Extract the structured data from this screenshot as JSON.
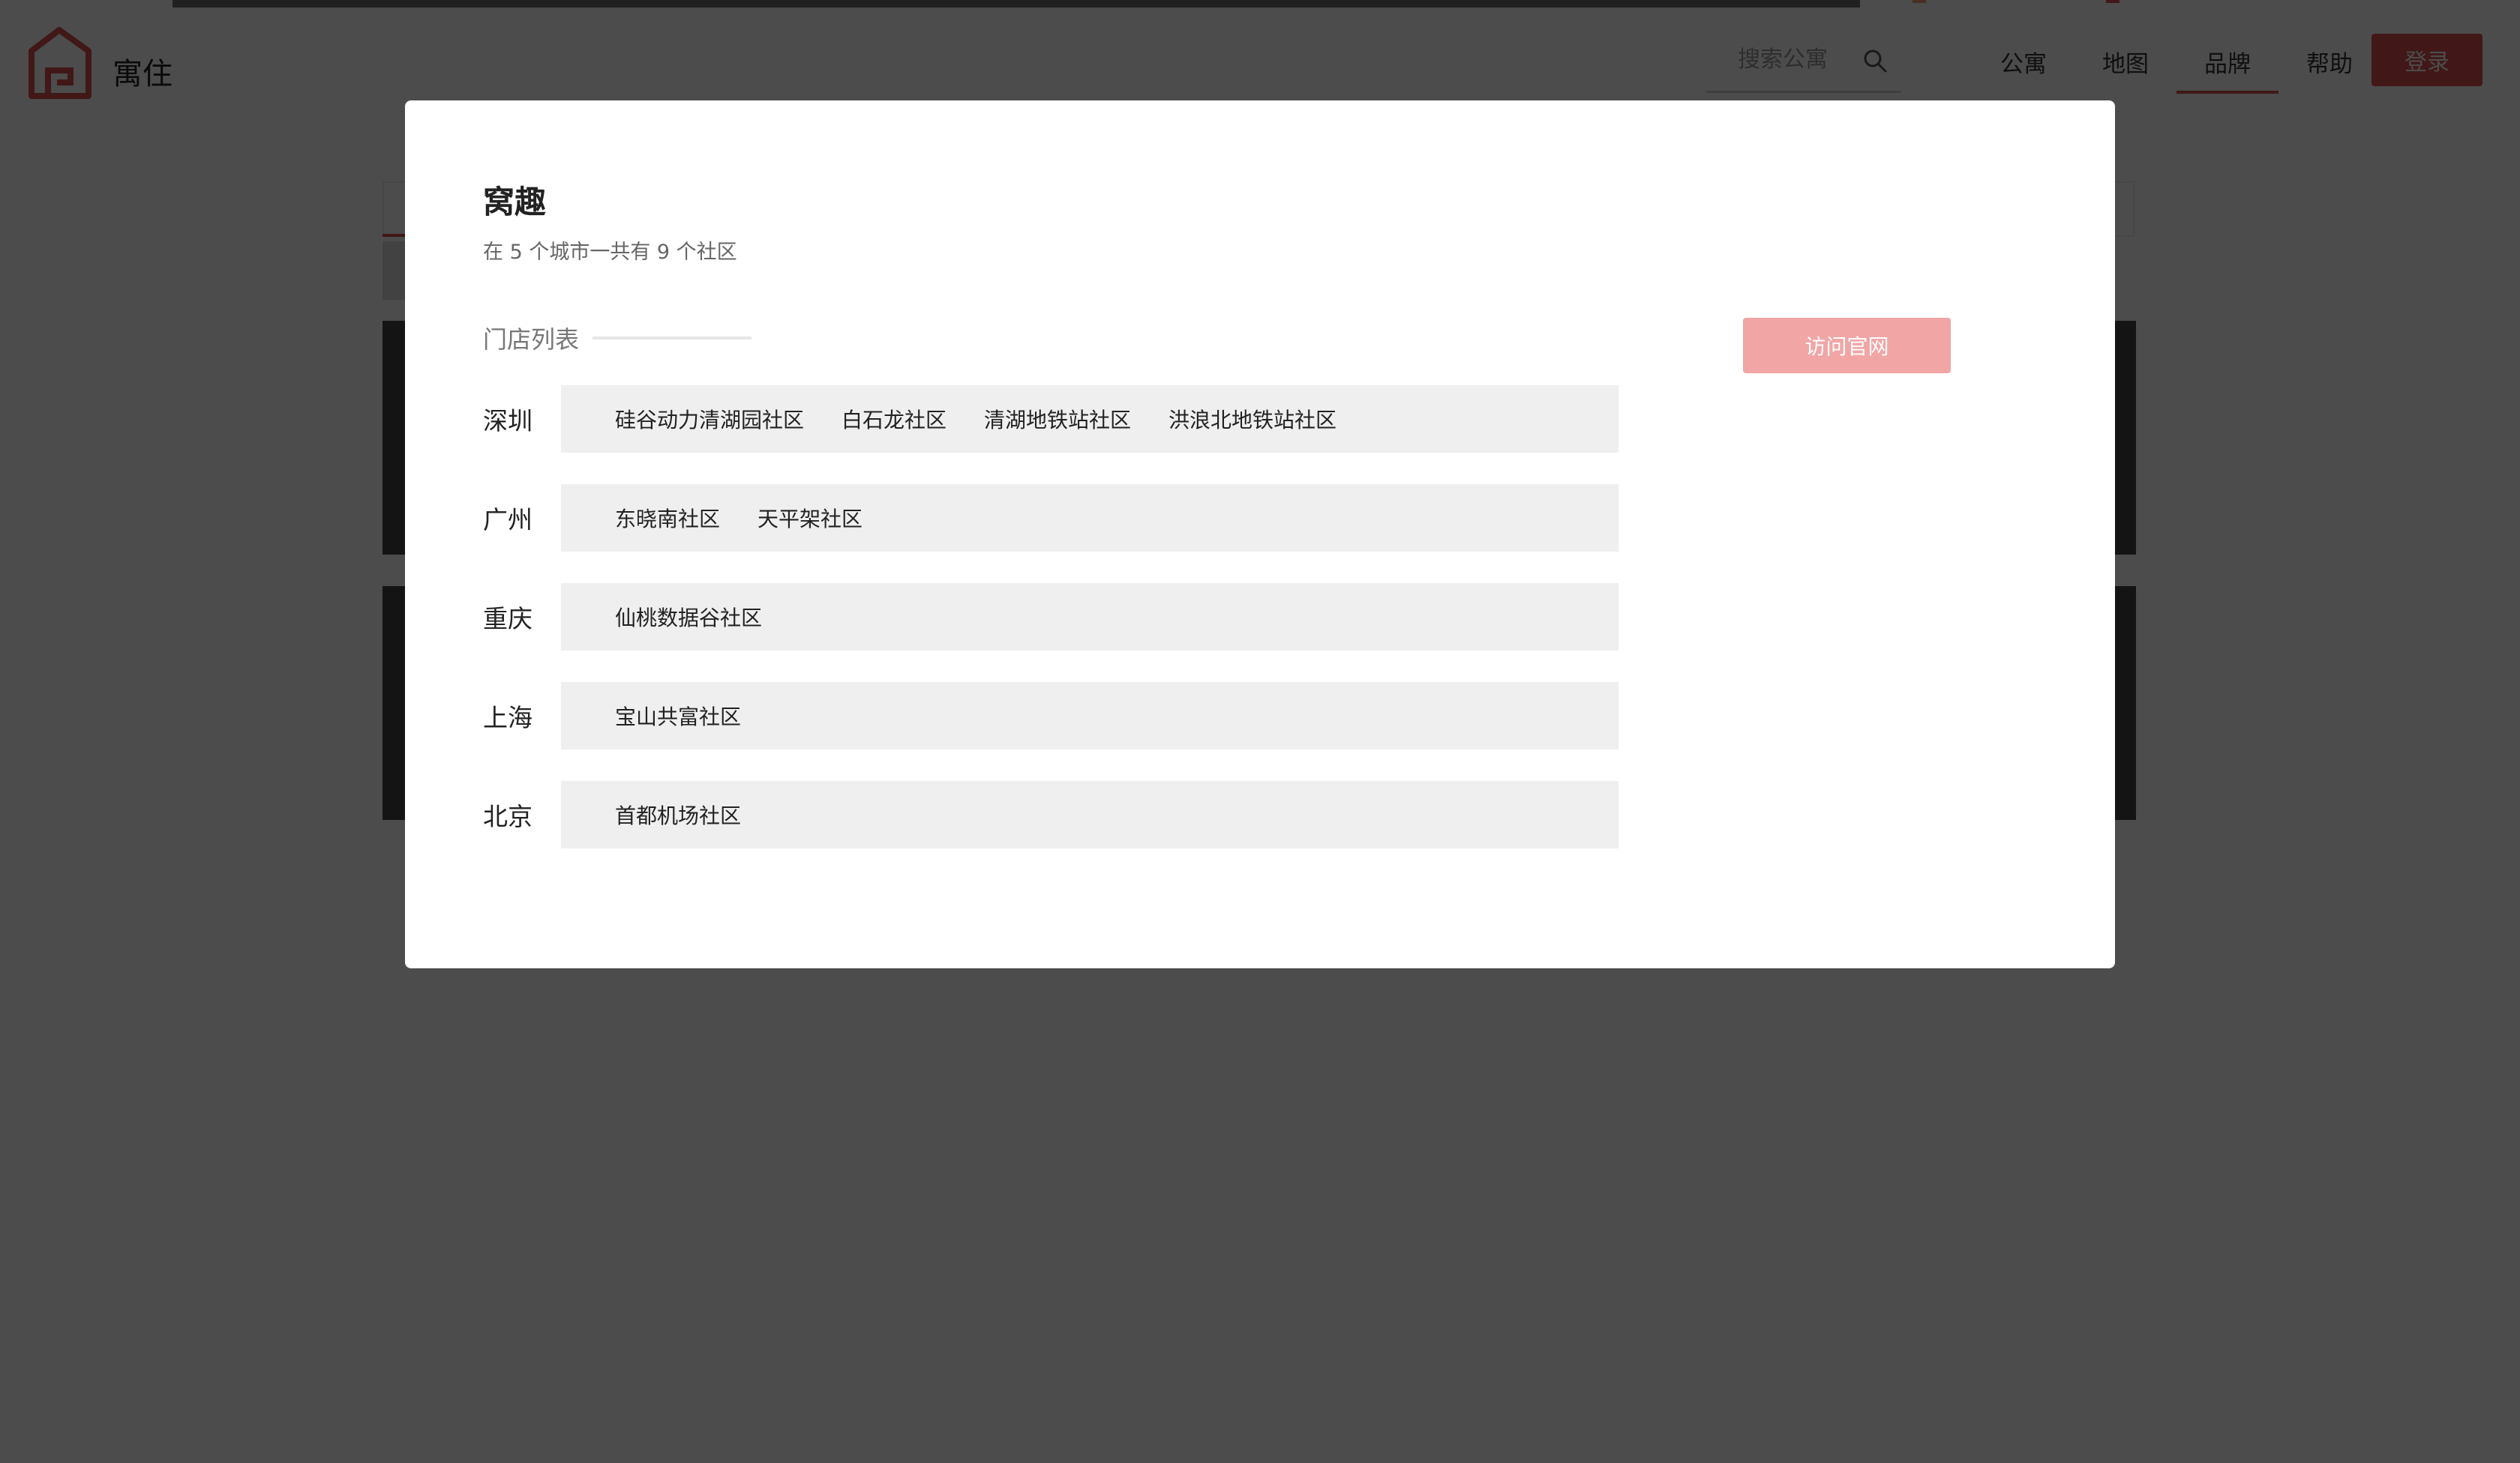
{
  "header": {
    "logo_text": "寓住",
    "search_placeholder": "搜索公寓",
    "nav": [
      "公寓",
      "地图",
      "品牌",
      "帮助"
    ],
    "active_nav": "品牌",
    "login_label": "登录"
  },
  "modal": {
    "title": "窝趣",
    "summary": "在 5 个城市一共有 9 个社区",
    "section_title": "门店列表",
    "visit_button": "访问官网",
    "cities": [
      {
        "name": "深圳",
        "stores": [
          "硅谷动力清湖园社区",
          "白石龙社区",
          "清湖地铁站社区",
          "洪浪北地铁站社区"
        ]
      },
      {
        "name": "广州",
        "stores": [
          "东晓南社区",
          "天平架社区"
        ]
      },
      {
        "name": "重庆",
        "stores": [
          "仙桃数据谷社区"
        ]
      },
      {
        "name": "上海",
        "stores": [
          "宝山共富社区"
        ]
      },
      {
        "name": "北京",
        "stores": [
          "首都机场社区"
        ]
      }
    ]
  },
  "colors": {
    "accent": "#d9534f",
    "visit_button_bg": "#f2a5a5",
    "store_box_bg": "#efefef",
    "overlay": "rgba(0,0,0,0.70)"
  },
  "icons": {
    "logo": "house-logo-icon",
    "search": "search-icon"
  }
}
